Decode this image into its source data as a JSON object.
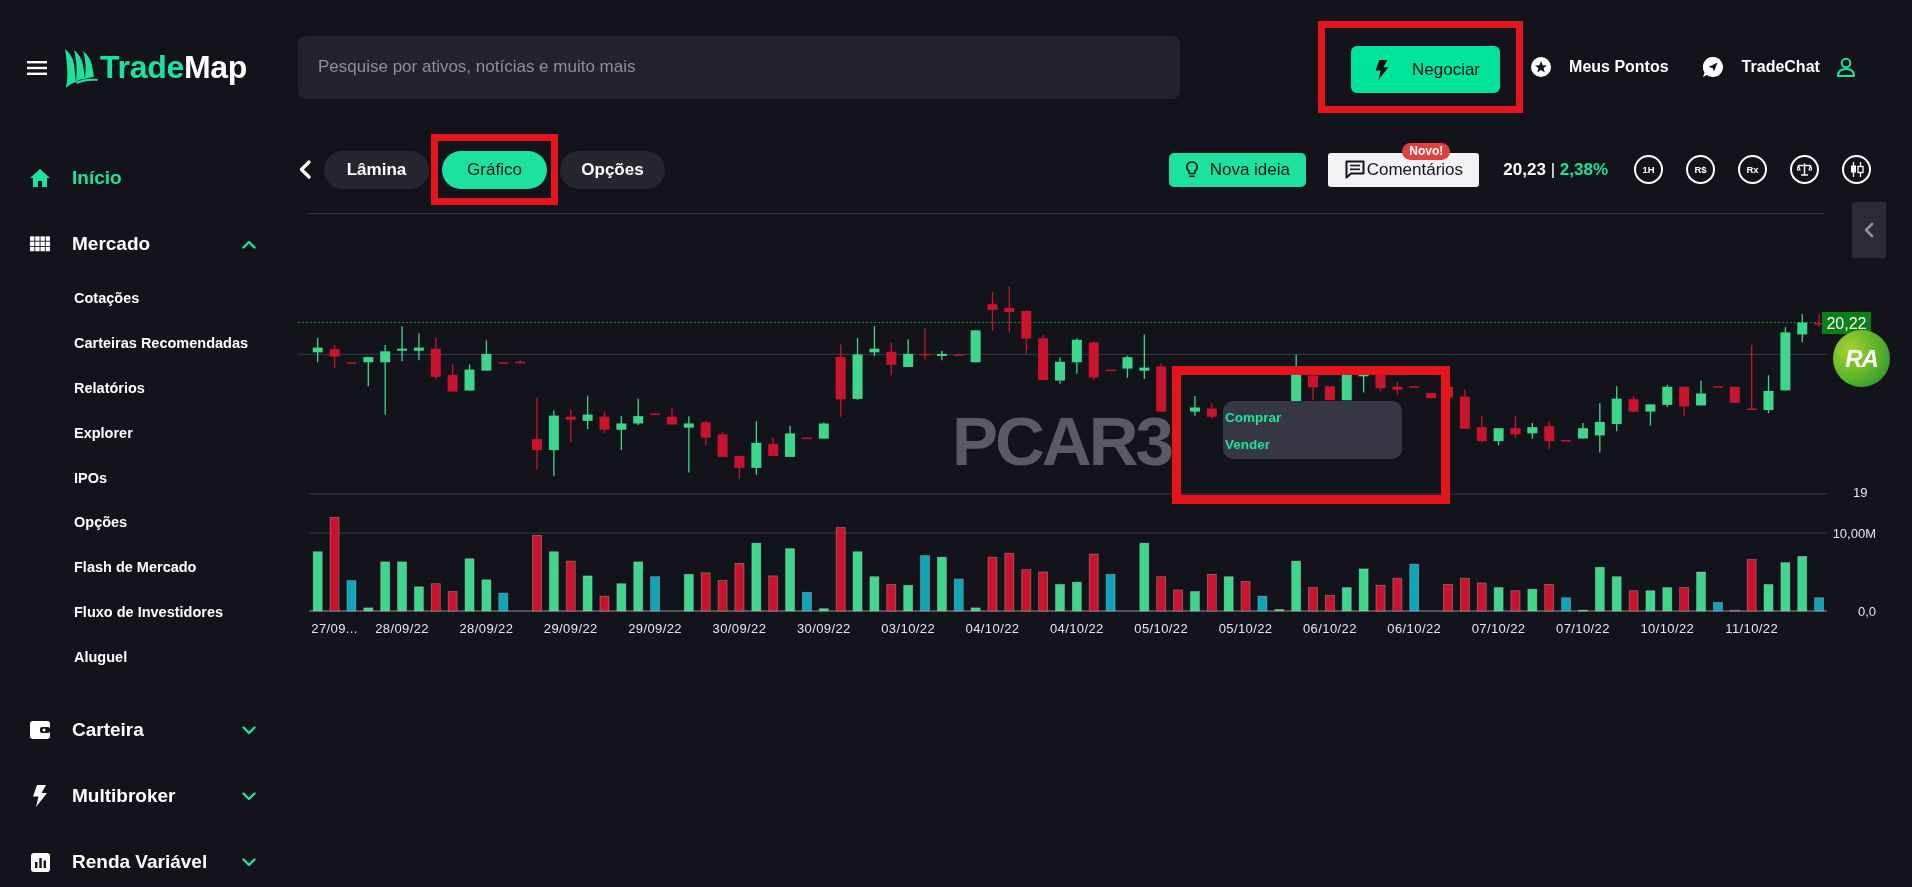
{
  "sidebar": {
    "logo": {
      "first": "Trade",
      "second": "Map"
    },
    "items": [
      {
        "label": "Início",
        "selected": true
      },
      {
        "label": "Mercado",
        "selected": false,
        "expanded": true,
        "children": [
          {
            "label": "Cotações",
            "selected": false
          },
          {
            "label": "Carteiras Recomendadas",
            "selected": false
          },
          {
            "label": "Relatórios",
            "selected": false
          },
          {
            "label": "Explorer",
            "selected": false
          },
          {
            "label": "IPOs",
            "selected": false
          },
          {
            "label": "Opções",
            "selected": false
          },
          {
            "label": "Flash de Mercado",
            "selected": false
          },
          {
            "label": "Fluxo de Investidores",
            "selected": false
          },
          {
            "label": "Aluguel",
            "selected": false
          }
        ]
      },
      {
        "label": "Carteira",
        "selected": false,
        "expanded": false
      },
      {
        "label": "Multibroker",
        "selected": false,
        "expanded": false
      },
      {
        "label": "Renda Variável",
        "selected": false,
        "expanded": false
      }
    ]
  },
  "top_bar": {
    "search": {
      "placeholder": "Pesquise por ativos, notícias e muito mais"
    },
    "trade_button": {
      "label": "Negociar",
      "highlighted": true
    },
    "points_link": {
      "label": "Meus Pontos"
    },
    "chat_link": {
      "label": "TradeChat"
    }
  },
  "tabs": [
    {
      "label": "Lâmina",
      "selected": false,
      "highlighted": false
    },
    {
      "label": "Gráfico",
      "selected": true,
      "highlighted": true
    },
    {
      "label": "Opções",
      "selected": false,
      "highlighted": false
    }
  ],
  "toolbar": {
    "idea_button": {
      "label": "Nova ideia"
    },
    "comments_button": {
      "label": "Comentários",
      "badge": "Novo!"
    },
    "quote": {
      "price": "20,23",
      "separator": "|",
      "change": "2,38%"
    },
    "tool_buttons": [
      "1H",
      "R$",
      "Rx"
    ]
  },
  "price_chart": {
    "ticker": "PCAR3",
    "axis_label": "19",
    "last_price": "20,22"
  },
  "context_menu": {
    "items": [
      "Comprar",
      "Vender"
    ],
    "highlighted": true
  },
  "rating_badge": {
    "label": "RA"
  },
  "volume_chart": {
    "date_labels": [
      "27/09...",
      "28/09/22",
      "28/09/22",
      "29/09/22",
      "29/09/22",
      "30/09/22",
      "30/09/22",
      "03/10/22",
      "04/10/22",
      "04/10/22",
      "05/10/22",
      "05/10/22",
      "06/10/22",
      "06/10/22",
      "07/10/22",
      "07/10/22",
      "10/10/22",
      "11/10/22"
    ],
    "chart_data": {
      "type": "bar",
      "stacked": true,
      "ylim": [
        0,
        15
      ],
      "yticks": [
        {
          "value": 0,
          "label": "0,0"
        },
        {
          "value": 10,
          "label": "10,00M"
        }
      ],
      "series": [
        {
          "color": "#3ed68a",
          "values": [
            7.6,
            null,
            null,
            0.4,
            6.3,
            6.3,
            3.1,
            null,
            null,
            6.7,
            4.0,
            null,
            null,
            null,
            7.6,
            null,
            4.5,
            null,
            3.5,
            6.3,
            null,
            null,
            4.7,
            null,
            null,
            null,
            8.7,
            null,
            8.0,
            null,
            0.3,
            null,
            7.6,
            4.4,
            null,
            3.3,
            null,
            6.9,
            null,
            0.4,
            null,
            null,
            null,
            null,
            3.4,
            3.7,
            null,
            null,
            null,
            8.7,
            null,
            null,
            2.5,
            null,
            4.4,
            null,
            null,
            0.2,
            6.4,
            null,
            null,
            3.0,
            5.4,
            null,
            null,
            null,
            null,
            null,
            null,
            null,
            3.0,
            null,
            2.8,
            null,
            null,
            0.1,
            5.6,
            4.4,
            null,
            2.6,
            3.0,
            null,
            5.0,
            null,
            null,
            null,
            3.4,
            6.2,
            7.0,
            null
          ]
        },
        {
          "color": "#c8142c",
          "values": [
            null,
            12.0,
            null,
            null,
            null,
            null,
            null,
            3.5,
            2.5,
            null,
            null,
            null,
            null,
            9.7,
            null,
            6.4,
            null,
            1.9,
            null,
            null,
            null,
            null,
            null,
            4.9,
            3.9,
            6.1,
            null,
            4.5,
            null,
            null,
            null,
            10.7,
            null,
            null,
            3.4,
            null,
            null,
            null,
            null,
            null,
            6.9,
            7.4,
            5.3,
            5.0,
            null,
            null,
            7.3,
            null,
            null,
            null,
            4.4,
            2.7,
            null,
            4.7,
            null,
            3.8,
            null,
            null,
            null,
            3.0,
            2.0,
            null,
            null,
            3.3,
            4.2,
            null,
            null,
            3.4,
            4.2,
            3.6,
            null,
            2.6,
            null,
            3.4,
            null,
            null,
            null,
            null,
            2.6,
            null,
            null,
            3.0,
            null,
            null,
            0.1,
            6.6,
            null,
            null,
            null,
            null
          ]
        },
        {
          "color": "#0ea5b8",
          "values": [
            null,
            null,
            3.9,
            null,
            null,
            null,
            null,
            null,
            null,
            null,
            null,
            2.3,
            null,
            null,
            null,
            null,
            null,
            null,
            null,
            null,
            4.4,
            null,
            null,
            null,
            null,
            null,
            null,
            null,
            null,
            2.4,
            null,
            null,
            null,
            null,
            null,
            null,
            7.1,
            null,
            4.1,
            null,
            null,
            null,
            null,
            null,
            null,
            null,
            null,
            4.7,
            null,
            null,
            null,
            null,
            null,
            null,
            null,
            null,
            1.9,
            null,
            null,
            null,
            null,
            null,
            null,
            null,
            null,
            6.0,
            null,
            null,
            null,
            null,
            null,
            null,
            null,
            null,
            1.7,
            null,
            null,
            null,
            null,
            null,
            null,
            null,
            null,
            1.1,
            null,
            null,
            null,
            null,
            null,
            1.7
          ]
        }
      ]
    }
  }
}
